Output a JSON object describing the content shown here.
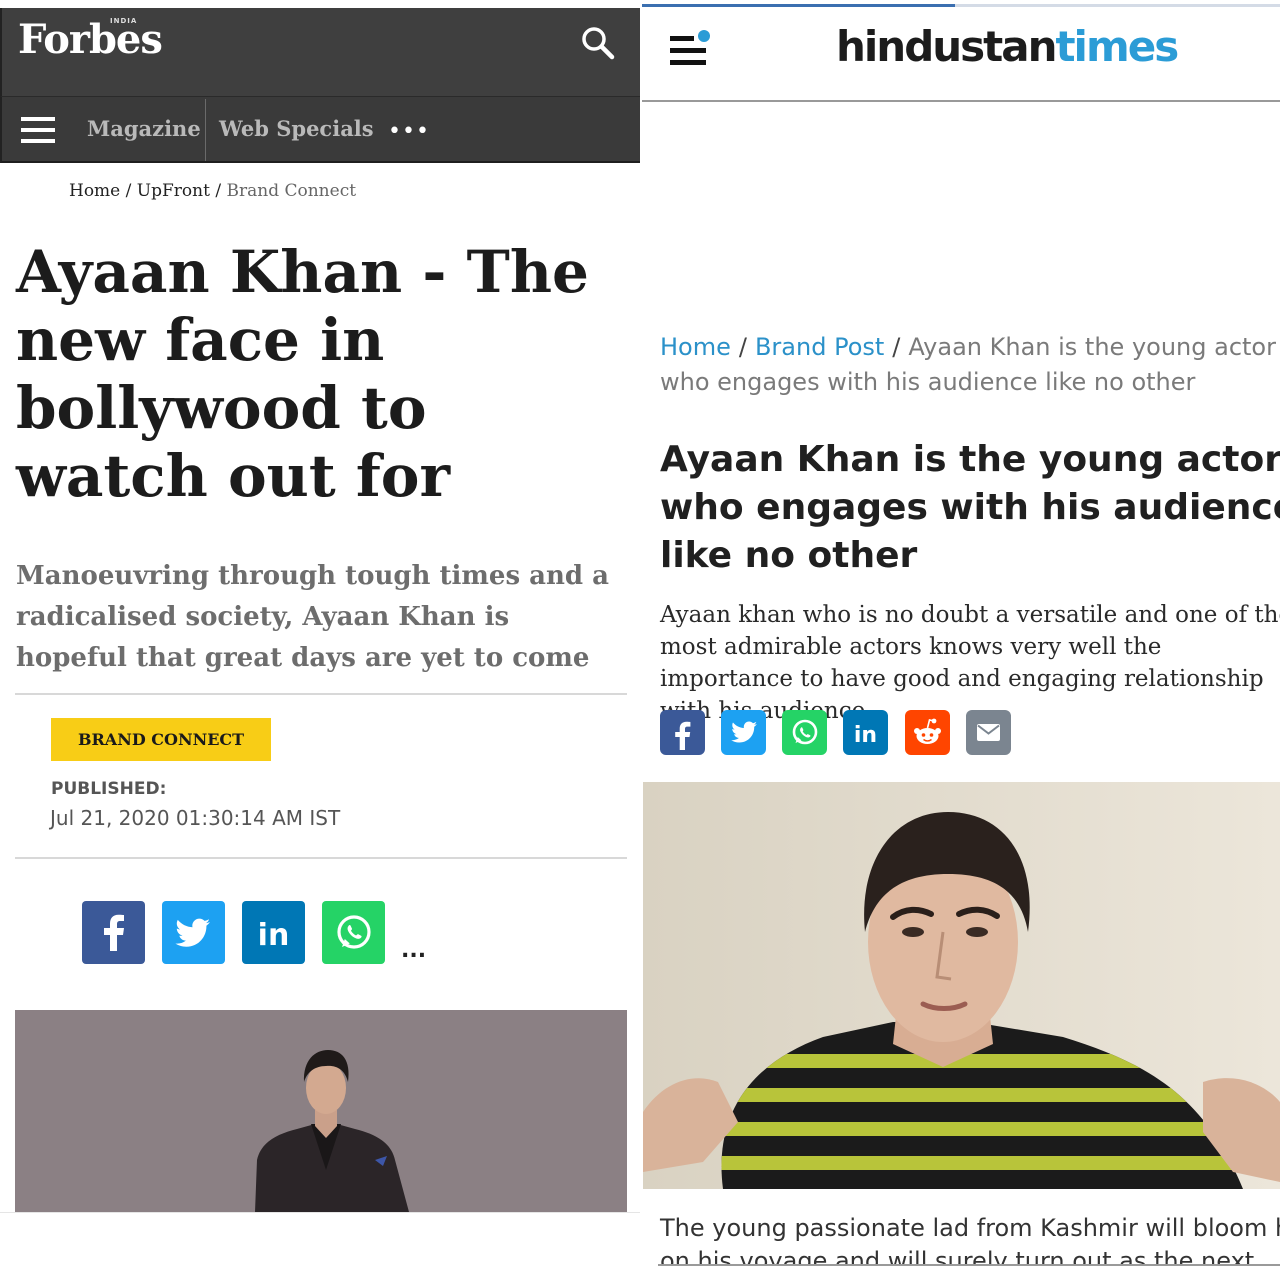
{
  "forbes": {
    "logo": "Forbes",
    "logo_edition": "INDIA",
    "nav": {
      "items": [
        "Magazine",
        "Web Specials"
      ],
      "more": "•••"
    },
    "breadcrumb": {
      "home": "Home",
      "section": "UpFront",
      "current": "Brand Connect",
      "sep": "/"
    },
    "article": {
      "title": "Ayaan Khan - The new face in bollywood to watch out for",
      "subtitle": "Manoeuvring through tough times and a radicalised society, Ayaan Khan is hopeful that great days are yet to come",
      "badge": "BRAND CONNECT",
      "published_label": "PUBLISHED:",
      "published_date": "Jul 21, 2020 01:30:14 AM IST"
    },
    "share": {
      "icons": [
        "facebook-icon",
        "twitter-icon",
        "linkedin-icon",
        "whatsapp-icon"
      ],
      "more": "..."
    },
    "colors": {
      "header_bg": "#3f3f3f",
      "badge_bg": "#f8cd16",
      "photo_bg": "#8b8084"
    }
  },
  "ht": {
    "logo_part1": "hindustan",
    "logo_part2": "times",
    "breadcrumb": {
      "home": "Home",
      "section": "Brand Post",
      "current": "Ayaan Khan is the young actor who engages with his audience like no other",
      "sep": "/"
    },
    "article": {
      "title": "Ayaan Khan is the young actor who engages with his audience like no other",
      "description": "Ayaan khan who is no doubt a versatile and one of the most admirable actors knows very well the importance to have good and engaging relationship with his audience.",
      "body_line1": "The young passionate lad from Kashmir will bloom high",
      "body_line2": "on his voyage and will surely turn out as the next"
    },
    "share": {
      "icons": [
        "facebook-icon",
        "twitter-icon",
        "whatsapp-icon",
        "linkedin-icon",
        "reddit-icon",
        "email-icon"
      ]
    },
    "colors": {
      "brand_blue": "#2b9cd6",
      "link_blue": "#2b91c9"
    },
    "scroll_progress": 0.49
  }
}
